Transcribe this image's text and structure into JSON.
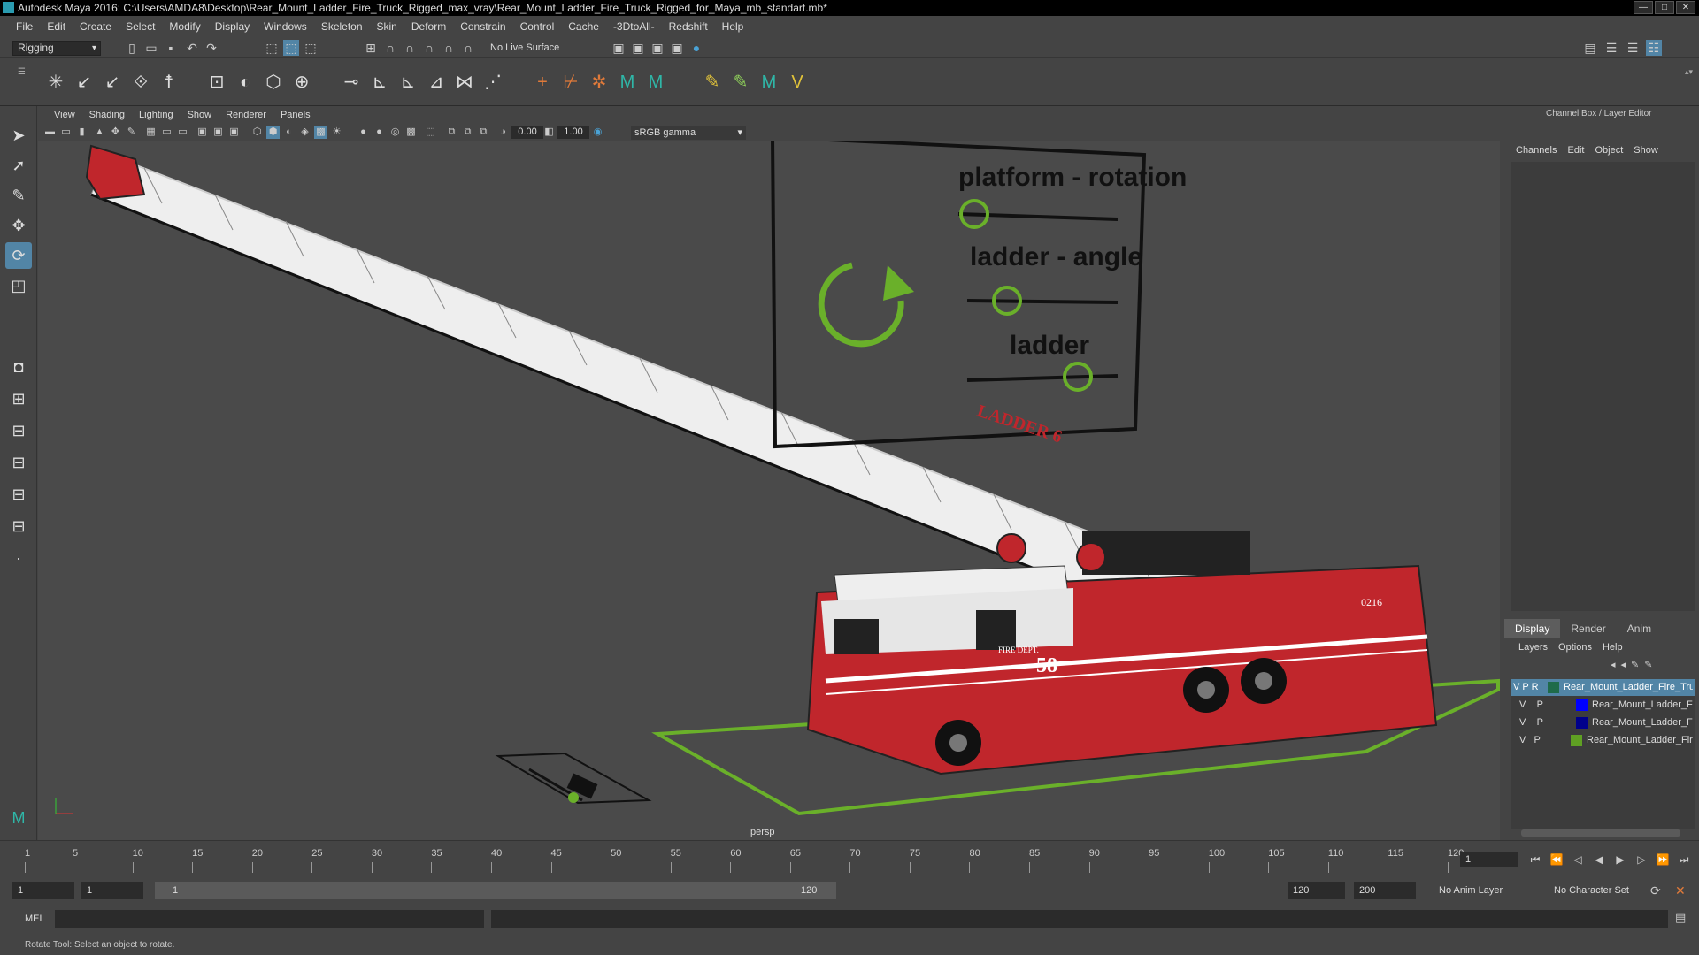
{
  "window": {
    "title": "Autodesk Maya 2016: C:\\Users\\AMDA8\\Desktop\\Rear_Mount_Ladder_Fire_Truck_Rigged_max_vray\\Rear_Mount_Ladder_Fire_Truck_Rigged_for_Maya_mb_standart.mb*",
    "min": "—",
    "max": "□",
    "close": "✕"
  },
  "menu": [
    "File",
    "Edit",
    "Create",
    "Select",
    "Modify",
    "Display",
    "Windows",
    "Skeleton",
    "Skin",
    "Deform",
    "Constrain",
    "Control",
    "Cache",
    "-3DtoAll-",
    "Redshift",
    "Help"
  ],
  "status": {
    "mode": "Rigging",
    "live_surface": "No Live Surface"
  },
  "panel": {
    "menu": [
      "View",
      "Shading",
      "Lighting",
      "Show",
      "Renderer",
      "Panels"
    ],
    "field1": "0.00",
    "field2": "1.00",
    "gamma": "sRGB gamma",
    "camera": "persp"
  },
  "viewport": {
    "label1": "platform - rotation",
    "label2": "ladder - angle",
    "label3": "ladder",
    "ladder_text": "LADDER 6",
    "truck_num": "58",
    "truck_id": "0216",
    "fire_dept": "FIRE DEPT."
  },
  "channelbox": {
    "title": "Channel Box / Layer Editor",
    "menu": [
      "Channels",
      "Edit",
      "Object",
      "Show"
    ]
  },
  "layereditor": {
    "tabs": [
      "Display",
      "Render",
      "Anim"
    ],
    "menu": [
      "Layers",
      "Options",
      "Help"
    ],
    "layers": [
      {
        "v": "V",
        "p": "P",
        "r": "R",
        "name": "Rear_Mount_Ladder_Fire_Tru",
        "color": "#1f6b4a",
        "selected": true
      },
      {
        "v": "V",
        "p": "P",
        "name": "Rear_Mount_Ladder_F",
        "color": "#0000ff"
      },
      {
        "v": "V",
        "p": "P",
        "name": "Rear_Mount_Ladder_F",
        "color": "#00008b"
      },
      {
        "v": "V",
        "p": "P",
        "name": "Rear_Mount_Ladder_Fir",
        "color": "#5fa023"
      }
    ]
  },
  "timeline": {
    "ticks": [
      "1",
      "5",
      "10",
      "15",
      "20",
      "25",
      "30",
      "35",
      "40",
      "45",
      "50",
      "55",
      "60",
      "65",
      "70",
      "75",
      "80",
      "85",
      "90",
      "95",
      "100",
      "105",
      "110",
      "115",
      "120"
    ],
    "current": "1"
  },
  "range": {
    "start": "1",
    "start2": "1",
    "slider_start": "1",
    "slider_end": "120",
    "end": "120",
    "end2": "200",
    "anim_layer": "No Anim Layer",
    "char_set": "No Character Set"
  },
  "mel": {
    "label": "MEL"
  },
  "help": {
    "text": "Rotate Tool: Select an object to rotate."
  }
}
